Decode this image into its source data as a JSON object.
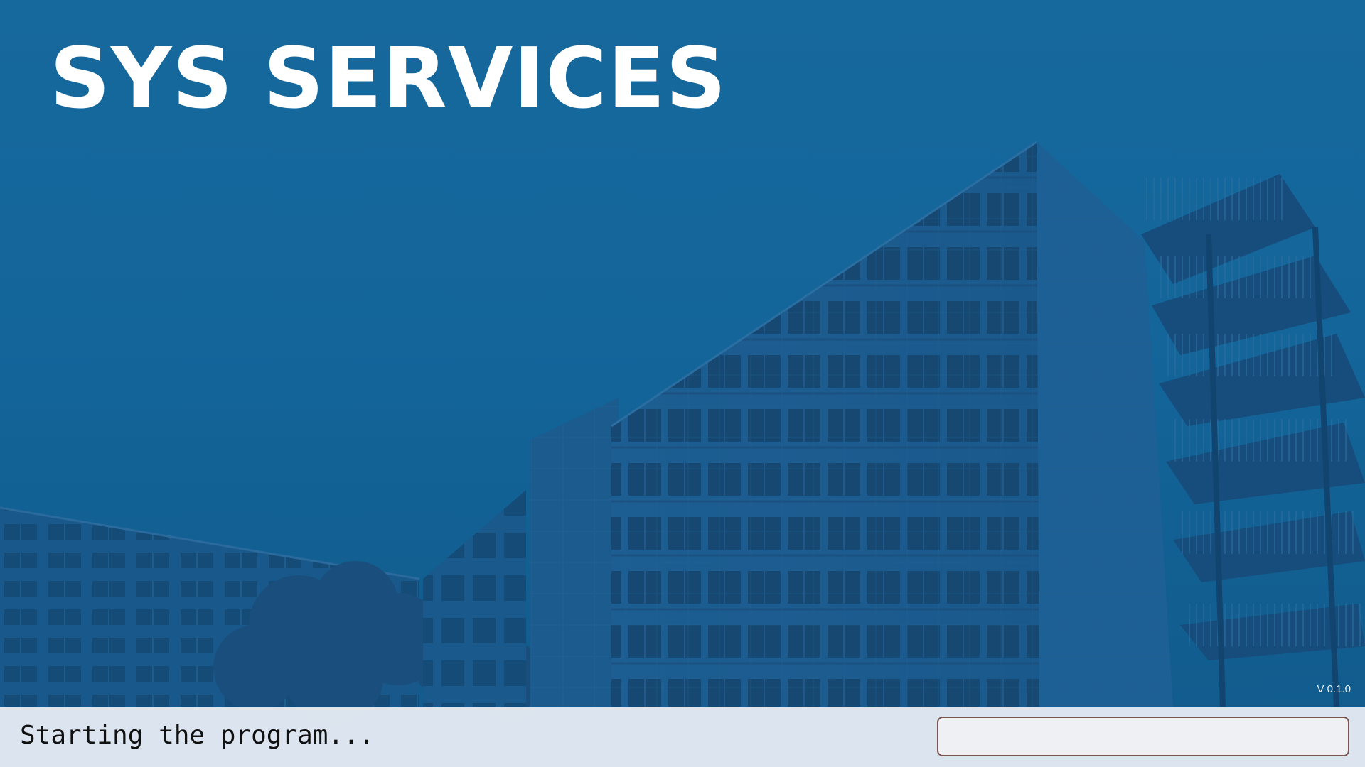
{
  "app": {
    "title": "SYS SERVICES",
    "version": "V 0.1.0"
  },
  "status": {
    "message": "Starting the program...",
    "progress": 0
  },
  "theme": {
    "accent": "#14679a",
    "status_bar": "#eceff5",
    "progress_border": "#7a5552"
  }
}
